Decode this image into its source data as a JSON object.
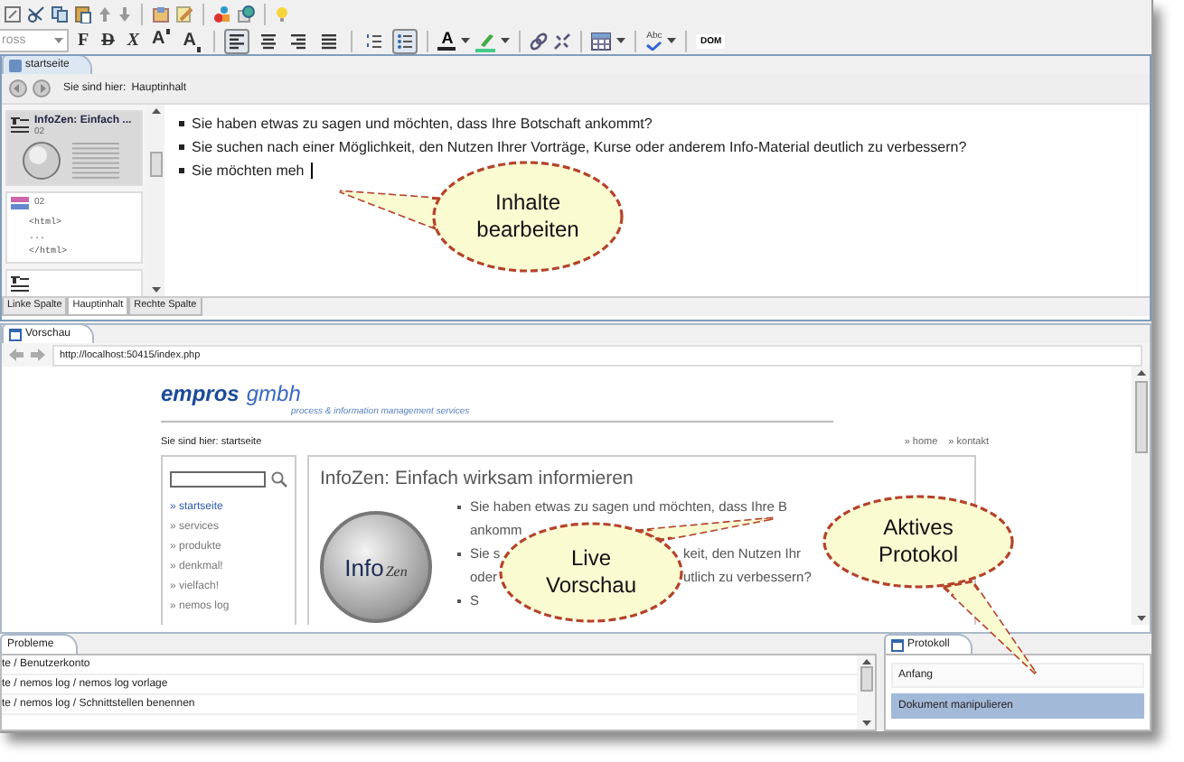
{
  "toolbar": {
    "font_field": {
      "value": "ross"
    },
    "format_buttons": [
      {
        "label": "F",
        "kind": "bold"
      },
      {
        "label": "D",
        "kind": "strike"
      },
      {
        "label": "X",
        "kind": "italic"
      },
      {
        "label": "A",
        "kind": "superscript"
      },
      {
        "label": "A",
        "kind": "subscript"
      }
    ],
    "align_buttons": [
      {
        "selected": true
      },
      {
        "selected": false
      },
      {
        "selected": false
      },
      {
        "selected": false
      }
    ],
    "list_buttons": [
      {
        "kind": "numbered",
        "selected": false
      },
      {
        "kind": "bulleted",
        "selected": true
      }
    ],
    "color_buttons": [
      {
        "kind": "font",
        "label": "A"
      },
      {
        "kind": "highlight"
      }
    ],
    "spell_button": {
      "label": "Abc"
    },
    "dom_button": {
      "label": "DOM"
    }
  },
  "editor": {
    "tab": "startseite",
    "breadcrumb_label": "Sie sind hier:",
    "breadcrumb_value": "Hauptinhalt",
    "blocks": [
      {
        "kind": "text",
        "title": "InfoZen: Einfach ...",
        "number": "02",
        "selected": true
      },
      {
        "kind": "html",
        "number": "02",
        "lines": [
          "<html>",
          "...",
          "</html>"
        ],
        "selected": false
      },
      {
        "kind": "text",
        "selected": false
      }
    ],
    "content": [
      "Sie haben etwas zu sagen und möchten, dass Ihre Botschaft ankommt?",
      "Sie suchen nach einer Möglichkeit, den Nutzen Ihrer Vorträge, Kurse oder anderem Info-Material deutlich zu verbessern?",
      "Sie möchten meh"
    ],
    "column_tabs": [
      {
        "label": "Linke Spalte",
        "selected": false
      },
      {
        "label": "Hauptinhalt",
        "selected": true
      },
      {
        "label": "Rechte Spalte",
        "selected": false
      }
    ]
  },
  "preview": {
    "tab": "Vorschau",
    "url": "http://localhost:50415/index.php",
    "site": {
      "logo_name": "empros",
      "logo_suffix": "gmbh",
      "tagline": "process & information management services",
      "breadcrumb": "Sie sind hier: startseite",
      "top_links": [
        "» home",
        "» kontakt"
      ],
      "nav": [
        {
          "label": "» startseite",
          "selected": true
        },
        {
          "label": "» services",
          "selected": false
        },
        {
          "label": "» produkte",
          "selected": false
        },
        {
          "label": "» denkmal!",
          "selected": false
        },
        {
          "label": "» vielfach!",
          "selected": false
        },
        {
          "label": "» nemos log",
          "selected": false
        }
      ],
      "heading": "InfoZen: Einfach wirksam informieren",
      "logo_text": "Info",
      "logo_script": "Zen",
      "bullets": [
        {
          "lines": [
            [
              "Sie haben etwas zu sagen und möchten, dass Ihre B"
            ],
            [
              "ankomm"
            ]
          ]
        },
        {
          "lines": [
            [
              "Sie s",
              "keit, den Nutzen Ihr"
            ],
            [
              "oder",
              "utlich zu verbessern?"
            ]
          ]
        },
        {
          "lines": [
            [
              "S"
            ]
          ]
        }
      ]
    }
  },
  "problems": {
    "tab": "Probleme",
    "rows": [
      "te / Benutzerkonto",
      "te / nemos log / nemos log vorlage",
      "te / nemos log / Schnittstellen benennen"
    ]
  },
  "protocol": {
    "tab": "Protokoll",
    "entries": [
      {
        "label": "Anfang",
        "selected": false
      },
      {
        "label": "Dokument manipulieren",
        "selected": true
      }
    ]
  },
  "callouts": [
    {
      "lines": [
        "Inhalte",
        "bearbeiten"
      ]
    },
    {
      "lines": [
        "Live",
        "Vorschau"
      ]
    },
    {
      "lines": [
        "Aktives",
        "Protokol"
      ]
    }
  ]
}
